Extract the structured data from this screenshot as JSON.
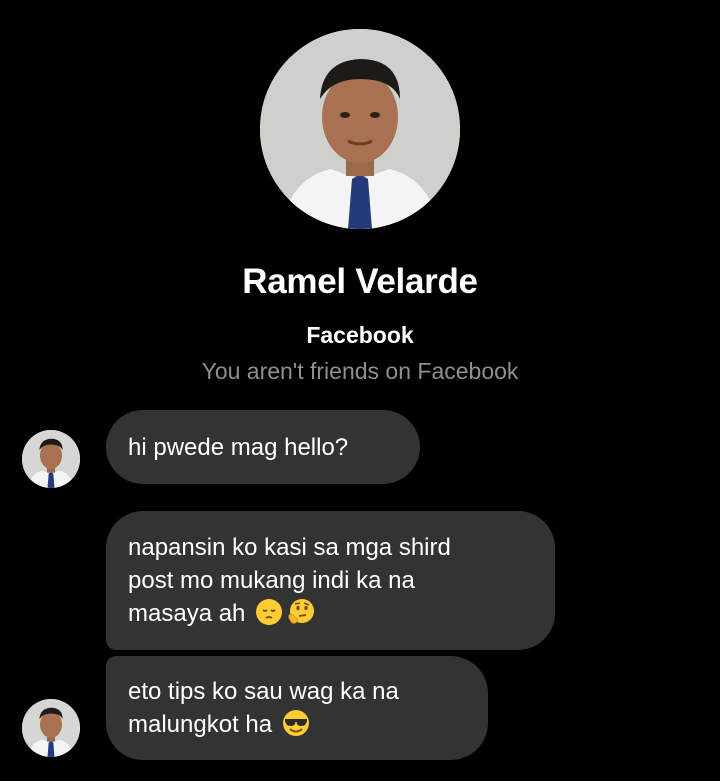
{
  "contact": {
    "name": "Ramel Velarde",
    "platform": "Facebook",
    "relationship_status": "You aren't friends on Facebook"
  },
  "messages": [
    {
      "lines": [
        "hi pwede mag hello?"
      ],
      "emojis": []
    },
    {
      "lines": [
        "napansin ko kasi sa mga shird",
        "post mo mukang indi ka na",
        "masaya ah"
      ],
      "emojis": [
        "pensive-face-emoji",
        "thinking-face-emoji"
      ]
    },
    {
      "lines": [
        "eto tips ko sau wag ka na",
        "malungkot ha"
      ],
      "emojis": [
        "smiling-face-with-sunglasses-emoji"
      ]
    }
  ],
  "colors": {
    "background": "#000000",
    "bubble": "#333333",
    "text": "#ffffff",
    "muted_text": "#8f8f8f"
  }
}
